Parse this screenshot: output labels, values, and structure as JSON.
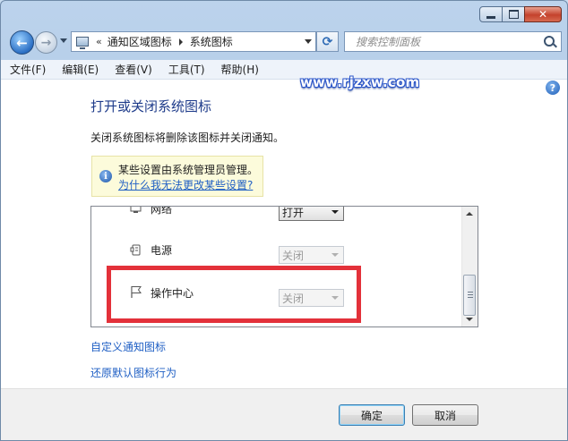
{
  "window": {
    "caption_buttons": [
      "minimize-icon",
      "maximize-icon",
      "close-icon"
    ]
  },
  "navigation": {
    "breadcrumb_prefix": "«",
    "breadcrumbs": [
      "通知区域图标",
      "系统图标"
    ],
    "search_placeholder": "搜索控制面板"
  },
  "menu": {
    "items": [
      "文件(F)",
      "编辑(E)",
      "查看(V)",
      "工具(T)",
      "帮助(H)"
    ]
  },
  "watermark": "www.rjzxw.com",
  "help_label": "?",
  "page": {
    "title": "打开或关闭系统图标",
    "description": "关闭系统图标将删除该图标并关闭通知。",
    "notice_text": "某些设置由系统管理员管理。",
    "notice_link": "为什么我无法更改某些设置?"
  },
  "system_icons": [
    {
      "name": "网络",
      "icon": "network-icon",
      "state": "打开",
      "enabled": true
    },
    {
      "name": "电源",
      "icon": "power-icon",
      "state": "关闭",
      "enabled": false
    },
    {
      "name": "操作中心",
      "icon": "flag-icon",
      "state": "关闭",
      "enabled": false
    }
  ],
  "links": {
    "customize": "自定义通知图标",
    "restore": "还原默认图标行为"
  },
  "buttons": {
    "ok": "确定",
    "cancel": "取消"
  },
  "colors": {
    "title_blue": "#1e3b8a",
    "link_blue": "#1f5fc4",
    "highlight_red": "#e3313a",
    "notice_bg": "#fcfbdb"
  }
}
